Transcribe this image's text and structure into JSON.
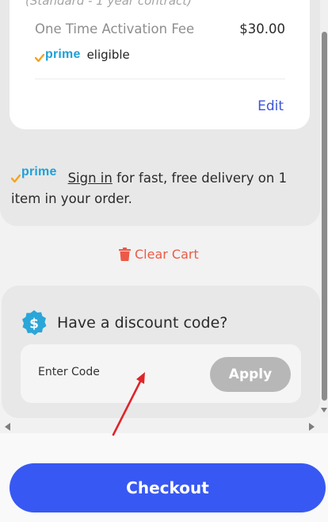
{
  "cart_item": {
    "cut_text": "(Standard - 1 year contract)",
    "fee_label": "One Time Activation Fee",
    "fee_price": "$30.00",
    "prime_word": "prime",
    "prime_eligible": "eligible",
    "edit_label": "Edit"
  },
  "prime_banner": {
    "prime_word": "prime",
    "signin_link": "Sign in",
    "message": " for fast, free delivery on 1 item in your order."
  },
  "clear_cart": {
    "label": "Clear Cart",
    "icon": "trash-icon",
    "color": "#ec5a47"
  },
  "discount": {
    "heading": "Have a discount code?",
    "icon": "dollar-badge-icon",
    "input_placeholder": "Enter Code",
    "apply_label": "Apply"
  },
  "checkout": {
    "label": "Checkout",
    "color": "#3858f3"
  }
}
